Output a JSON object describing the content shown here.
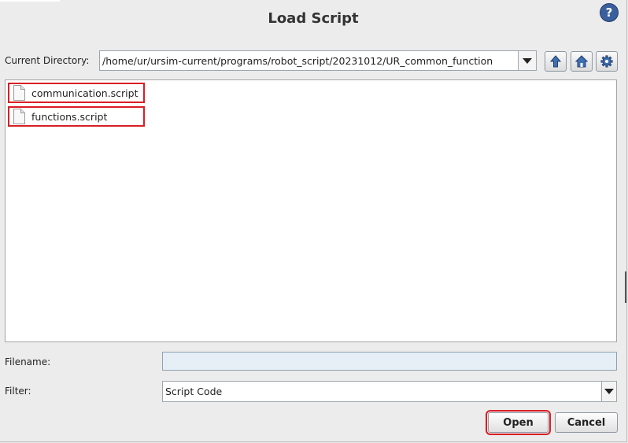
{
  "dialog": {
    "title": "Load Script",
    "help_glyph": "?"
  },
  "directory": {
    "label": "Current Directory:",
    "path": "/home/ur/ursim-current/programs/robot_script/20231012/UR_common_function",
    "toolbar_icons": [
      "arrow-up-icon",
      "home-icon",
      "gear-icon"
    ]
  },
  "files": [
    {
      "name": "communication.script",
      "icon": "document-icon"
    },
    {
      "name": "functions.script",
      "icon": "document-icon"
    }
  ],
  "filename": {
    "label": "Filename:",
    "value": ""
  },
  "filter": {
    "label": "Filter:",
    "selected": "Script Code"
  },
  "buttons": {
    "open": "Open",
    "cancel": "Cancel"
  },
  "colors": {
    "highlight": "#d91e25",
    "help_blue": "#3a5f9c"
  }
}
